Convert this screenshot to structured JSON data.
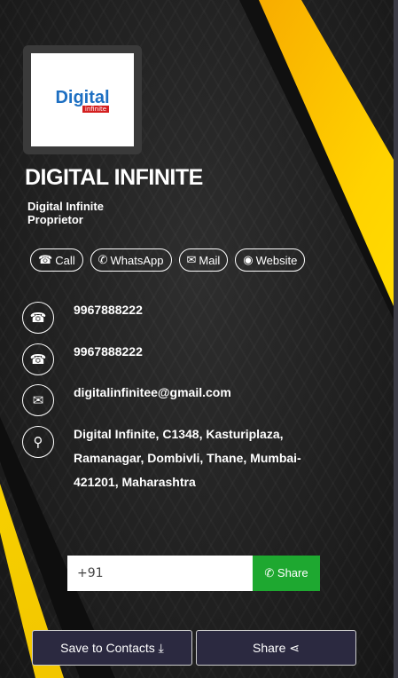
{
  "logo": {
    "text_main": "Digital",
    "text_sub": "infinite"
  },
  "profile": {
    "name": "DIGITAL INFINITE",
    "company": "Digital Infinite",
    "role": "Proprietor"
  },
  "actions": [
    {
      "label": "Call",
      "icon": "☎"
    },
    {
      "label": "WhatsApp",
      "icon": "✆"
    },
    {
      "label": "Mail",
      "icon": "✉"
    },
    {
      "label": "Website",
      "icon": "◉"
    }
  ],
  "contacts": [
    {
      "icon": "☎",
      "text": "9967888222"
    },
    {
      "icon": "☎",
      "text": "9967888222"
    },
    {
      "icon": "✉",
      "text": "digitalinfinitee@gmail.com"
    },
    {
      "icon": "⚲",
      "text": "Digital Infinite, C1348, Kasturiplaza, Ramanagar, Dombivli, Thane, Mumbai-421201, Maharashtra"
    }
  ],
  "whatsapp_share": {
    "value": "+91",
    "button": "✆ Share"
  },
  "footer": {
    "save": "Save to Contacts ⤓",
    "share": "Share ⋖"
  },
  "colors": {
    "accent": "#ffd200",
    "whatsapp": "#1ea830",
    "button_bg": "#2b2940"
  }
}
